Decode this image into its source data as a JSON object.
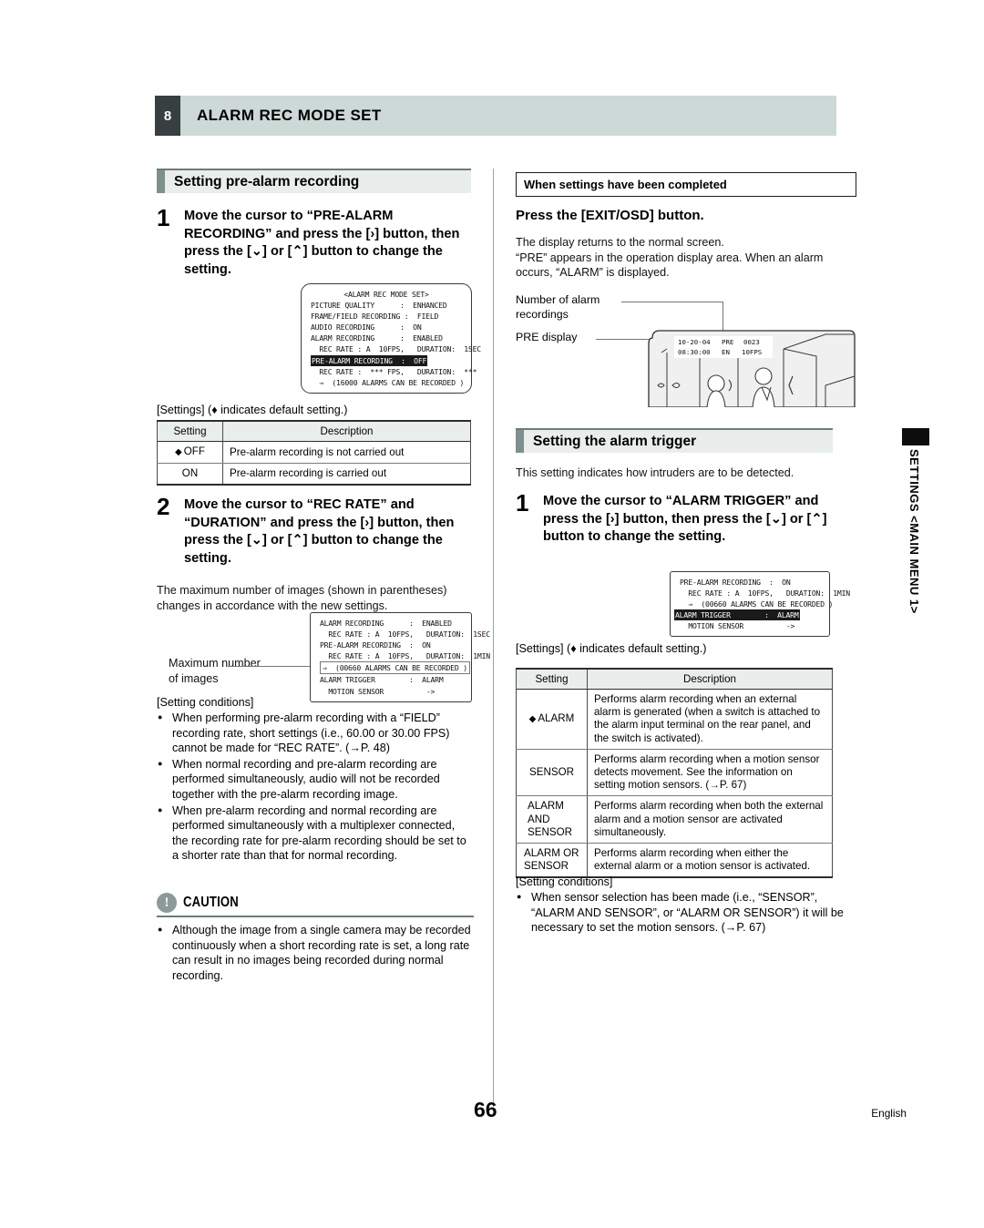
{
  "chapter": {
    "number": "8",
    "title": "ALARM REC MODE SET"
  },
  "left": {
    "section_title": "Setting pre-alarm recording",
    "step1": {
      "num": "1",
      "text": "Move the cursor to “PRE-ALARM RECORDING” and press the [›] button, then press the [⌄] or [⌃] button to change the setting."
    },
    "osd1": {
      "title": "<ALARM REC MODE SET>",
      "rows": [
        "PICTURE QUALITY      :  ENHANCED",
        "FRAME/FIELD RECORDING :  FIELD",
        "AUDIO RECORDING      :  ON",
        "ALARM RECORDING      :  ENABLED",
        "  REC RATE : A  10FPS,   DURATION:  1SEC"
      ],
      "highlight_row": "PRE-ALARM RECORDING  :  OFF",
      "rows_after": [
        "  REC RATE :  *** FPS,   DURATION:  ***",
        "  ⇒  (16000 ALARMS CAN BE RECORDED )"
      ]
    },
    "settings_caption": "[Settings] (♦ indicates default setting.)",
    "table1": {
      "headers": [
        "Setting",
        "Description"
      ],
      "rows": [
        {
          "setting": "OFF",
          "default": true,
          "description": "Pre-alarm recording is not carried out"
        },
        {
          "setting": "ON",
          "default": false,
          "description": "Pre-alarm recording is carried out"
        }
      ]
    },
    "step2": {
      "num": "2",
      "text": "Move the cursor to “REC RATE” and “DURATION” and press the [›] button, then press the [⌄] or [⌃] button to change the setting."
    },
    "step2_note": "The maximum number of images (shown in parentheses) changes in accordance with the new settings.",
    "osd2_label": "Maximum number\nof images",
    "osd2": {
      "rows_before": [
        "ALARM RECORDING      :  ENABLED",
        "  REC RATE : A  10FPS,   DURATION:  1SEC",
        "PRE-ALARM RECORDING  :  ON",
        "  REC RATE : A  10FPS,   DURATION:  1MIN"
      ],
      "boxed_row": "⇒  (00660 ALARMS CAN BE RECORDED )",
      "rows_after": [
        "ALARM TRIGGER        :  ALARM",
        "  MOTION SENSOR          ->"
      ]
    },
    "conditions_label": "[Setting conditions]",
    "conditions": [
      "When performing pre-alarm recording with a “FIELD” recording rate, short settings (i.e., 60.00 or 30.00 FPS) cannot be made for “REC RATE”. (→P. 48)",
      "When normal recording and pre-alarm recording are performed simultaneously, audio will not be recorded together with the pre-alarm recording image.",
      "When pre-alarm recording and normal recording are performed simultaneously with a multiplexer connected, the recording rate for pre-alarm recording should be set to a shorter rate than that for normal recording."
    ],
    "caution": {
      "icon_char": "!",
      "title": "CAUTION",
      "items": [
        "Although the image from a single camera may be recorded continuously when a short recording rate is set, a long rate can result in no images being recorded during normal recording."
      ]
    }
  },
  "right": {
    "completed_head": "When settings have been completed",
    "completed_sub": "Press the [EXIT/OSD] button.",
    "completed_body": "The display returns to the normal screen.\n“PRE” appears in the operation display area. When an alarm occurs, “ALARM” is displayed.",
    "illustration": {
      "label_alarm_count": "Number of alarm\nrecordings",
      "label_pre": "PRE display",
      "osd_line1_date": "10-20-04",
      "osd_line1_pre": "PRE",
      "osd_line1_count": "0023",
      "osd_line2_time": "08:30:00",
      "osd_line2_en": "EN",
      "osd_line2_fps": "10FPS"
    },
    "section_title": "Setting the alarm trigger",
    "intro": "This setting indicates how intruders are to be detected.",
    "step1": {
      "num": "1",
      "text": "Move the cursor to “ALARM TRIGGER” and press the [›] button, then press the [⌄] or [⌃] button to change the setting."
    },
    "osd3": {
      "rows_before": [
        "PRE-ALARM RECORDING  :  ON",
        "  REC RATE : A  10FPS,   DURATION:  1MIN",
        "  ⇒  (00660 ALARMS CAN BE RECORDED )"
      ],
      "highlight_row": "ALARM TRIGGER        :  ALARM",
      "rows_after": [
        "  MOTION SENSOR          ->"
      ]
    },
    "settings_caption": "[Settings] (♦ indicates default setting.)",
    "table2": {
      "headers": [
        "Setting",
        "Description"
      ],
      "rows": [
        {
          "setting": "ALARM",
          "default": true,
          "description": "Performs alarm recording when an external alarm is generated (when a switch is attached to the alarm input terminal on the rear panel, and the switch is activated)."
        },
        {
          "setting": "SENSOR",
          "default": false,
          "description": "Performs alarm recording when a motion sensor detects movement. See the information on setting motion sensors. (→P. 67)"
        },
        {
          "setting": "ALARM\nAND\nSENSOR",
          "default": false,
          "description": "Performs alarm recording when both the external alarm and a motion sensor are activated simultaneously."
        },
        {
          "setting": "ALARM OR\nSENSOR",
          "default": false,
          "description": "Performs alarm recording when either the external alarm or a motion sensor is activated."
        }
      ]
    },
    "conditions_label": "[Setting conditions]",
    "conditions": [
      "When sensor selection has been made (i.e., “SENSOR”, “ALARM AND SENSOR”, or “ALARM OR SENSOR”) it will be necessary to set the motion sensors. (→P. 67)"
    ]
  },
  "side_tab": {
    "label": "SETTINGS <MAIN MENU 1>"
  },
  "footer": {
    "page_number": "66",
    "language": "English"
  }
}
